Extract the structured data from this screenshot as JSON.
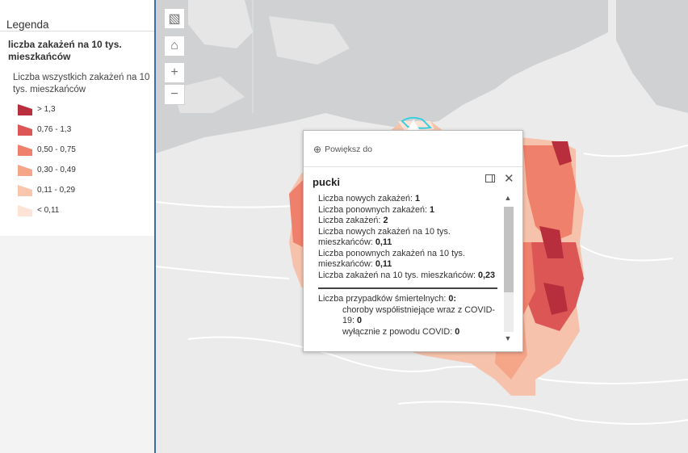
{
  "legend": {
    "heading": "Legenda",
    "layer_title": "liczba zakażeń na 10 tys. mieszkańców",
    "field_label": "Liczba wszystkich zakażeń na 10 tys. mieszkańców",
    "classes": [
      {
        "label": "> 1,3",
        "color": "#b92e3c"
      },
      {
        "label": "0,76 - 1,3",
        "color": "#dd5656"
      },
      {
        "label": "0,50 - 0,75",
        "color": "#ef806b"
      },
      {
        "label": "0,30 - 0,49",
        "color": "#f5a588"
      },
      {
        "label": "0,11 - 0,29",
        "color": "#f9c5ad"
      },
      {
        "label": "< 0,11",
        "color": "#fde3d6"
      }
    ]
  },
  "map_controls": {
    "basemap_icon": "basemap-gallery-icon",
    "home_icon": "home-icon",
    "zoom_in": "+",
    "zoom_out": "−"
  },
  "popup": {
    "zoom_to": "Powiększ do",
    "title": "pucki",
    "fields": [
      {
        "label": "Liczba nowych zakażeń: ",
        "value": "1"
      },
      {
        "label": "Liczba ponownych zakażeń: ",
        "value": "1"
      },
      {
        "label": "Liczba zakażeń: ",
        "value": "2"
      },
      {
        "label": "Liczba nowych zakażeń na 10 tys. mieszkańców: ",
        "value": "0,11"
      },
      {
        "label": "Liczba ponownych zakażeń na 10 tys. mieszkańców: ",
        "value": "0,11"
      },
      {
        "label": "Liczba zakażeń na 10 tys. mieszkańców: ",
        "value": "0,23"
      }
    ],
    "deaths": {
      "label": "Liczba przypadków śmiertelnych: ",
      "value": "0:"
    },
    "death_details": [
      {
        "label": "choroby współistniejące wraz z COVID-19: ",
        "value": "0"
      },
      {
        "label": "wyłącznie z powodu COVID: ",
        "value": "0"
      }
    ]
  }
}
